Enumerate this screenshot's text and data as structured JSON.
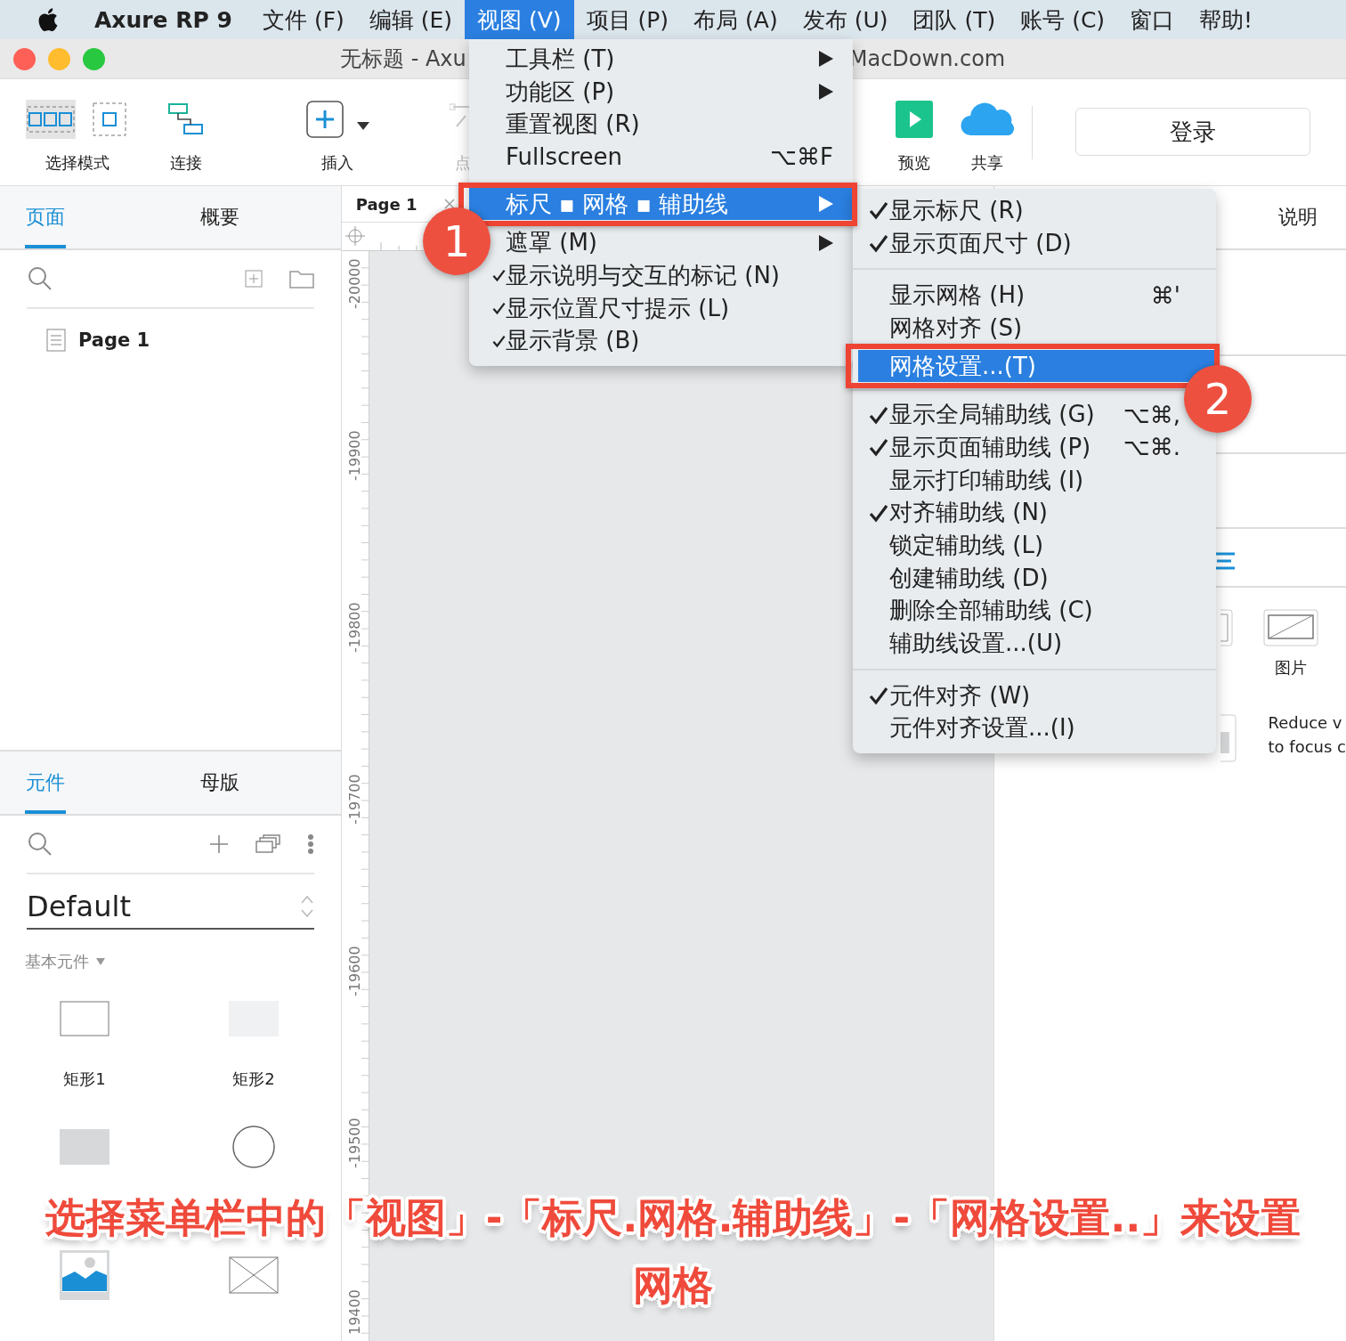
{
  "menubar": {
    "items": [
      {
        "label": "Axure RP 9",
        "kind": "app",
        "selected": false
      },
      {
        "label": "文件 (F)",
        "kind": "menu",
        "selected": false
      },
      {
        "label": "编辑 (E)",
        "kind": "menu",
        "selected": false
      },
      {
        "label": "视图 (V)",
        "kind": "menu",
        "selected": true
      },
      {
        "label": "项目 (P)",
        "kind": "menu",
        "selected": false
      },
      {
        "label": "布局 (A)",
        "kind": "menu",
        "selected": false
      },
      {
        "label": "发布 (U)",
        "kind": "menu",
        "selected": false
      },
      {
        "label": "团队 (T)",
        "kind": "menu",
        "selected": false
      },
      {
        "label": "账号 (C)",
        "kind": "menu",
        "selected": false
      },
      {
        "label": "窗口",
        "kind": "menu",
        "selected": false
      },
      {
        "label": "帮助!",
        "kind": "menu",
        "selected": false
      }
    ]
  },
  "window": {
    "title_left": "无标题 - Axu",
    "title_right": "MacDown.com"
  },
  "toolbar": {
    "tools": [
      {
        "label": "选择模式",
        "kind": "select",
        "selected": true,
        "disabled": false
      },
      {
        "label": "连接",
        "kind": "connect",
        "selected": false,
        "disabled": false
      },
      {
        "label": "插入",
        "kind": "insert",
        "selected": false,
        "disabled": false
      },
      {
        "label": "点",
        "kind": "point",
        "selected": false,
        "disabled": true
      }
    ],
    "actions": [
      {
        "label": "预览",
        "kind": "preview"
      },
      {
        "label": "共享",
        "kind": "share"
      }
    ],
    "login": "登录"
  },
  "pages_panel": {
    "tabs": [
      {
        "label": "页面",
        "selected": true
      },
      {
        "label": "概要",
        "selected": false
      }
    ],
    "pages": [
      "Page 1"
    ]
  },
  "library_panel": {
    "tabs": [
      {
        "label": "元件",
        "selected": true
      },
      {
        "label": "母版",
        "selected": false
      }
    ],
    "library": "Default",
    "group": "基本元件",
    "widgets": [
      {
        "label": "矩形1",
        "kind": "rect"
      },
      {
        "label": "矩形2",
        "kind": "rect-light"
      },
      {
        "kind": "rect-grey"
      },
      {
        "kind": "circle"
      },
      {
        "kind": "image"
      },
      {
        "kind": "placeholder"
      }
    ]
  },
  "canvas": {
    "tab": "Page 1",
    "ruler_labels": [
      "-20000",
      "-19900",
      "-19800",
      "-19700",
      "-19600",
      "-19500",
      "19400"
    ]
  },
  "right_panel": {
    "tab": "说明",
    "widget_label": "图片",
    "note_lines": [
      "Reduce v",
      "to focus c"
    ]
  },
  "view_menu": {
    "items": [
      {
        "kind": "item",
        "label": "工具栏 (T)",
        "checked": false,
        "submenu": true,
        "selected": false
      },
      {
        "kind": "item",
        "label": "功能区 (P)",
        "checked": false,
        "submenu": true,
        "selected": false
      },
      {
        "kind": "item",
        "label": "重置视图 (R)",
        "checked": false,
        "submenu": false,
        "selected": false
      },
      {
        "kind": "item",
        "label": "Fullscreen",
        "shortcut": "⌥⌘F",
        "checked": false,
        "submenu": false,
        "selected": false
      },
      {
        "kind": "separator"
      },
      {
        "kind": "item",
        "label": "标尺 ▪ 网格 ▪ 辅助线",
        "checked": false,
        "submenu": true,
        "selected": true
      },
      {
        "kind": "item",
        "label": "遮罩 (M)",
        "checked": false,
        "submenu": true,
        "selected": false
      },
      {
        "kind": "item",
        "label": "显示说明与交互的标记 (N)",
        "checked": true,
        "submenu": false,
        "selected": false
      },
      {
        "kind": "item",
        "label": "显示位置尺寸提示 (L)",
        "checked": true,
        "submenu": false,
        "selected": false
      },
      {
        "kind": "item",
        "label": "显示背景 (B)",
        "checked": true,
        "submenu": false,
        "selected": false
      }
    ]
  },
  "sub_menu": {
    "items": [
      {
        "kind": "item",
        "label": "显示标尺 (R)",
        "checked": true,
        "selected": false
      },
      {
        "kind": "item",
        "label": "显示页面尺寸 (D)",
        "checked": true,
        "selected": false
      },
      {
        "kind": "separator"
      },
      {
        "kind": "item",
        "label": "显示网格 (H)",
        "shortcut": "⌘'",
        "checked": false,
        "selected": false
      },
      {
        "kind": "item",
        "label": "网格对齐 (S)",
        "checked": false,
        "selected": false
      },
      {
        "kind": "item",
        "label": "网格设置...(T)",
        "checked": false,
        "selected": true
      },
      {
        "kind": "separator"
      },
      {
        "kind": "item",
        "label": "显示全局辅助线 (G)",
        "shortcut": "⌥⌘,",
        "checked": true,
        "selected": false
      },
      {
        "kind": "item",
        "label": "显示页面辅助线 (P)",
        "shortcut": "⌥⌘.",
        "checked": true,
        "selected": false
      },
      {
        "kind": "item",
        "label": "显示打印辅助线 (I)",
        "checked": false,
        "selected": false
      },
      {
        "kind": "item",
        "label": "对齐辅助线 (N)",
        "checked": true,
        "selected": false
      },
      {
        "kind": "item",
        "label": "锁定辅助线 (L)",
        "checked": false,
        "selected": false
      },
      {
        "kind": "item",
        "label": "创建辅助线 (D)",
        "checked": false,
        "selected": false
      },
      {
        "kind": "item",
        "label": "删除全部辅助线 (C)",
        "checked": false,
        "selected": false
      },
      {
        "kind": "item",
        "label": "辅助线设置...(U)",
        "checked": false,
        "selected": false
      },
      {
        "kind": "separator"
      },
      {
        "kind": "item",
        "label": "元件对齐 (W)",
        "checked": true,
        "selected": false
      },
      {
        "kind": "item",
        "label": "元件对齐设置...(I)",
        "checked": false,
        "selected": false
      }
    ]
  },
  "callouts": [
    "1",
    "2"
  ],
  "caption_lines": [
    "选择菜单栏中的「视图」-「标尺.网格.辅助线」-「网格设置..」来设置",
    "网格"
  ]
}
